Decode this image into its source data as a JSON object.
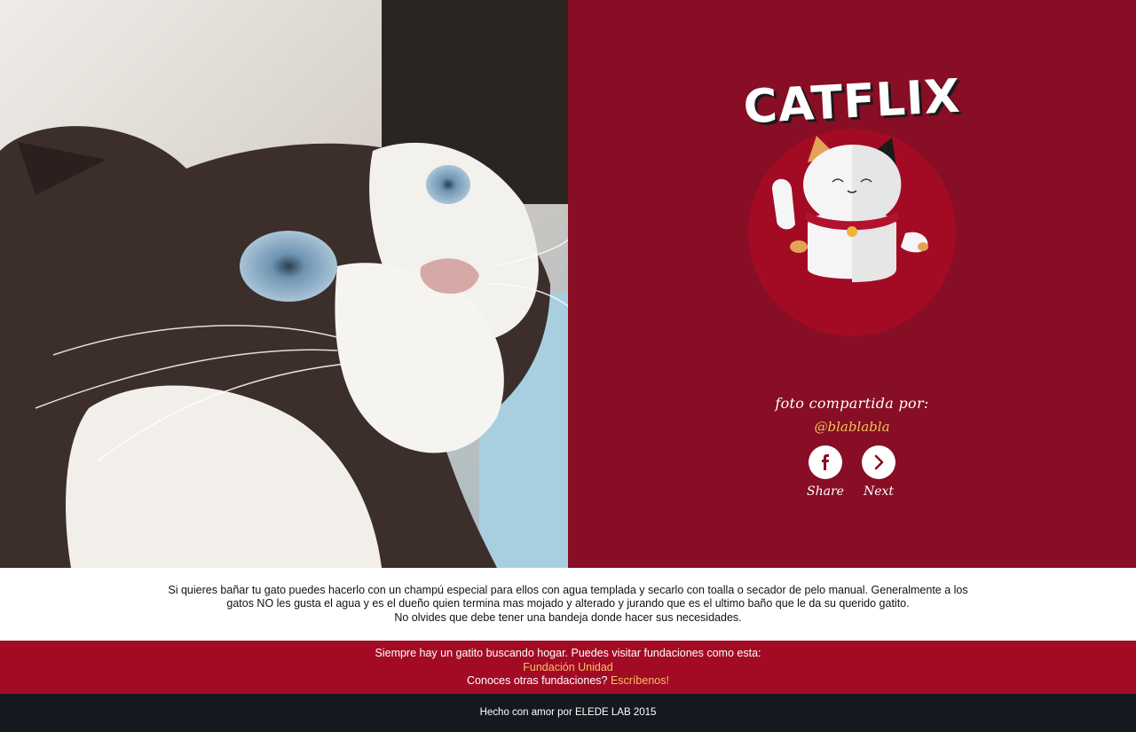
{
  "brand": {
    "title": "CATFLIX",
    "colors": {
      "brand_bg": "#870e25",
      "accent_red": "#a30b24",
      "gold": "#f3c261",
      "footer_bg": "#14191f"
    }
  },
  "photo": {
    "alt": "cat photo"
  },
  "credit": {
    "label": "foto compartida por:",
    "user": "@blablabla"
  },
  "actions": {
    "share": {
      "label": "Share",
      "icon": "facebook-icon"
    },
    "next": {
      "label": "Next",
      "icon": "chevron-right-icon"
    }
  },
  "description": {
    "line1": "Si quieres bañar tu gato puedes hacerlo con un champú especial para ellos con agua templada y secarlo con toalla o secador de pelo manual. Generalmente a los gatos NO les gusta el agua y es el dueño quien termina mas mojado y alterado y jurando que es el ultimo baño que le da su querido gatito.",
    "line2": "No olvides que debe tener una bandeja donde hacer sus necesidades."
  },
  "adopt": {
    "intro": "Siempre hay un gatito buscando hogar. Puedes visitar fundaciones como esta:",
    "foundation_link": "Fundación Unidad",
    "question": "Conoces otras fundaciones?",
    "contact_link": "Escríbenos!"
  },
  "footer": {
    "text": "Hecho con amor por ELEDE LAB 2015"
  }
}
